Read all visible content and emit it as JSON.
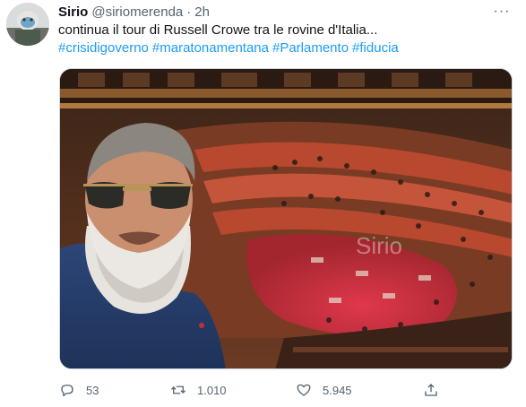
{
  "tweet": {
    "author_name": "Sirio",
    "author_handle": "@siriomerenda",
    "separator": "·",
    "time": "2h",
    "more_label": "···",
    "text": "continua il tour di Russell Crowe tra le rovine d'Italia...",
    "hashtags": [
      "#crisidigoverno",
      "#maratonamentana",
      "#Parlamento",
      "#fiducia"
    ],
    "image_watermark": "Sirio",
    "image_alt": "Selfie of a bearded man in sunglasses in front of the Italian Senate chamber"
  },
  "actions": {
    "reply_count": "53",
    "retweet_count": "1.010",
    "like_count": "5.945",
    "icons": [
      "reply-icon",
      "retweet-icon",
      "like-icon",
      "share-icon"
    ]
  },
  "colors": {
    "link": "#1d9bf0",
    "secondary_text": "#536471",
    "primary_text": "#0f1419"
  }
}
